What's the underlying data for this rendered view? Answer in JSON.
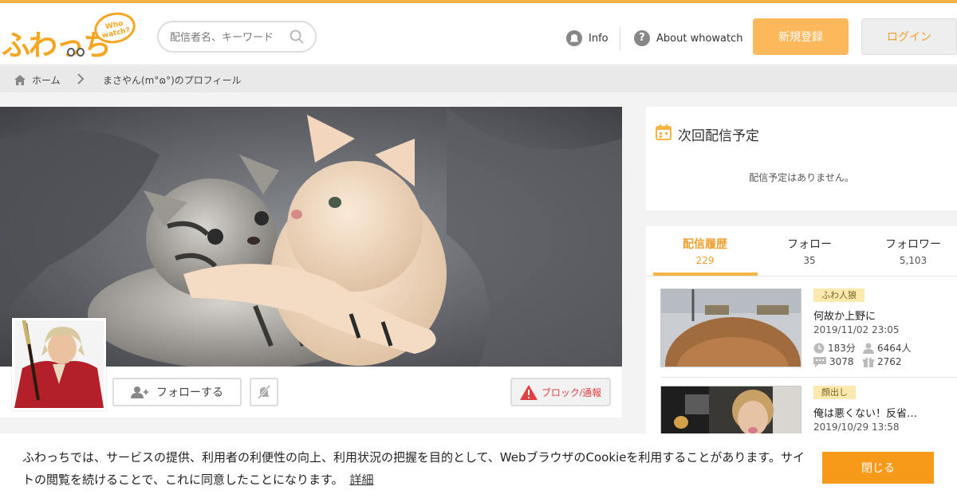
{
  "header": {
    "logo_text": "ふわっち",
    "logo_bubble": "Who watch?",
    "search_placeholder": "配信者名、キーワード",
    "nav_info": "Info",
    "nav_about": "About whowatch",
    "register_label": "新規登録",
    "login_label": "ログイン"
  },
  "breadcrumb": {
    "home": "ホーム",
    "current": "まさやん(m°ɷ°)のプロフィール"
  },
  "profile": {
    "follow_label": "フォローする",
    "block_label": "ブロック/通報"
  },
  "schedule": {
    "title": "次回配信予定",
    "empty": "配信予定はありません。"
  },
  "history": {
    "tabs": [
      {
        "label": "配信履歴",
        "count": "229"
      },
      {
        "label": "フォロー",
        "count": "35"
      },
      {
        "label": "フォロワー",
        "count": "5,103"
      }
    ],
    "items": [
      {
        "tag": "ふわ人狼",
        "title": "何故か上野に",
        "date": "2019/11/02 23:05",
        "duration": "183分",
        "viewers": "6464人",
        "comments": "3078",
        "gifts": "2762"
      },
      {
        "tag": "顔出し",
        "title": "俺は悪くない！反省…",
        "date": "2019/10/29 13:58"
      }
    ]
  },
  "cookie": {
    "text": "ふわっちでは、サービスの提供、利用者の利便性の向上、利用状況の把握を目的として、WebブラウザのCookieを利用することがあります。サイトの閲覧を続けることで、これに同意したことになります。",
    "link": "詳細",
    "close": "閉じる"
  },
  "colors": {
    "accent": "#f6b447",
    "register": "#fcb85a",
    "close": "#f79a1a",
    "danger": "#e04040"
  }
}
